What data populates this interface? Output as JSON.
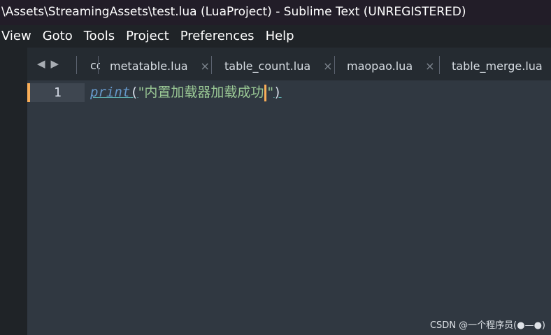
{
  "window": {
    "title": "\\Assets\\StreamingAssets\\test.lua (LuaProject) - Sublime Text (UNREGISTERED)"
  },
  "menu": {
    "items": [
      "View",
      "Goto",
      "Tools",
      "Project",
      "Preferences",
      "Help"
    ]
  },
  "tabs": {
    "partial_label": "co",
    "items": [
      {
        "label": "metatable.lua",
        "close": "×"
      },
      {
        "label": "table_count.lua",
        "close": "×"
      },
      {
        "label": "maopao.lua",
        "close": "×"
      },
      {
        "label": "table_merge.lua",
        "close": "×"
      }
    ],
    "nav_left": "◀",
    "nav_right": "▶"
  },
  "editor": {
    "line_number": "1",
    "code": {
      "func": "print",
      "open_paren": "(",
      "string_before_caret": "\"内置加载器加载成功",
      "string_after_caret": "\"",
      "close_paren": ")"
    }
  },
  "watermark": "CSDN @一个程序员(●—●)",
  "colors": {
    "accent_caret": "#f9ae58",
    "string": "#99c794",
    "function": "#6699cc"
  }
}
